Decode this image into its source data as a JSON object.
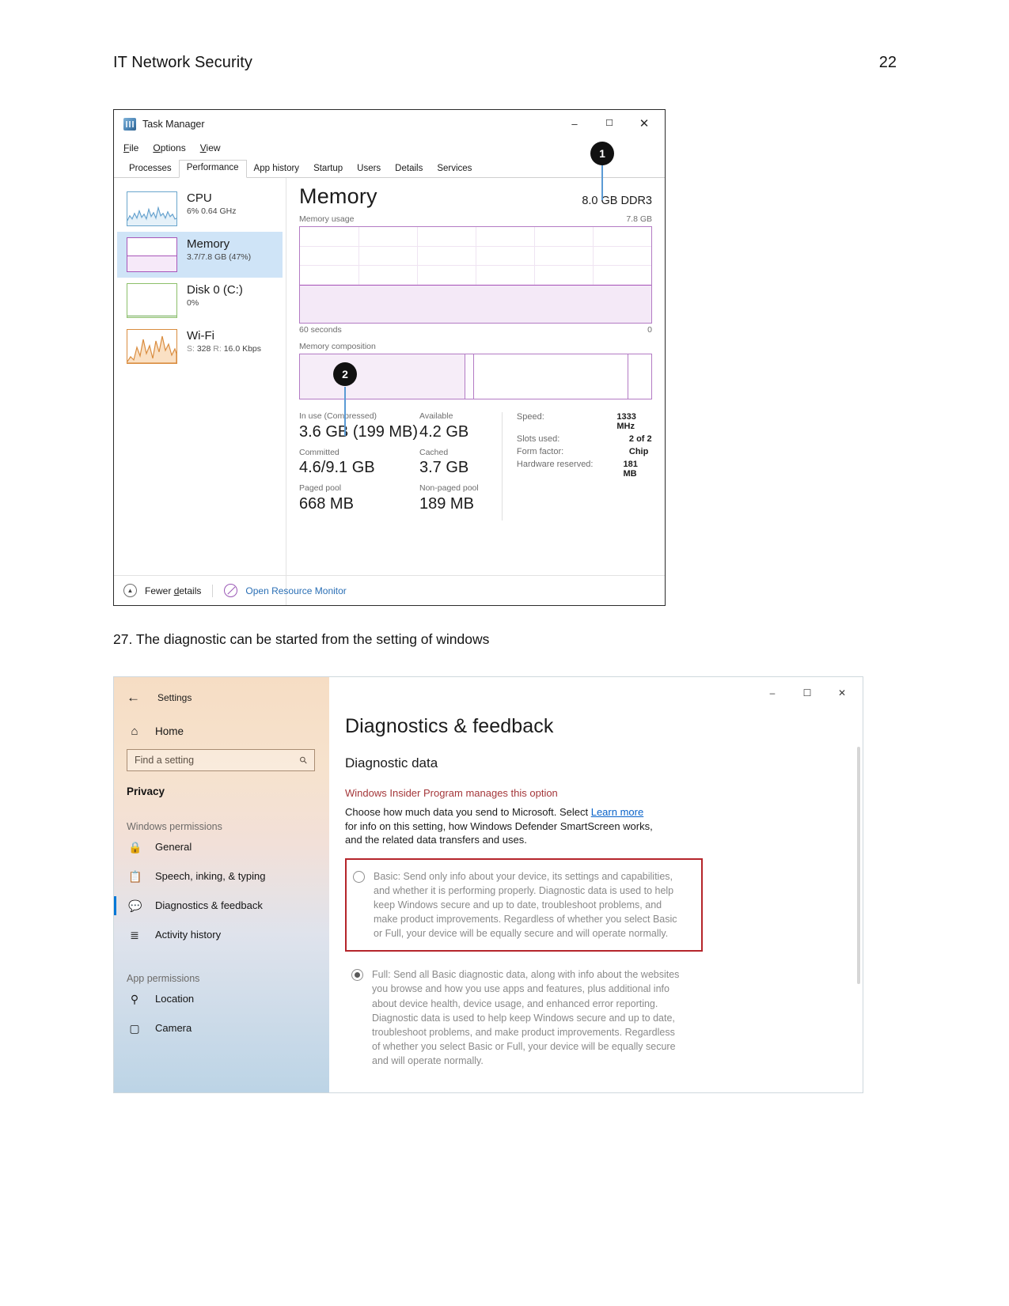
{
  "page": {
    "doc_title": "IT Network Security",
    "page_number": "22"
  },
  "task_manager": {
    "window_title": "Task Manager",
    "app_icon": "task-manager-icon",
    "window_controls": {
      "minimize": "–",
      "maximize": "☐",
      "close": "✕"
    },
    "menus": [
      "File",
      "Options",
      "View"
    ],
    "tabs": [
      "Processes",
      "Performance",
      "App history",
      "Startup",
      "Users",
      "Details",
      "Services"
    ],
    "active_tab": "Performance",
    "resources": [
      {
        "name": "CPU",
        "detail": "6%  0.64 GHz",
        "selected": false,
        "graph_color": "#4a90c4"
      },
      {
        "name": "Memory",
        "detail": "3.7/7.8 GB (47%)",
        "selected": true,
        "graph_color": "#a855b9"
      },
      {
        "name": "Disk 0 (C:)",
        "detail": "0%",
        "selected": false,
        "graph_color": "#6aa84f"
      },
      {
        "name": "Wi-Fi",
        "detail_prefix_s": "S:",
        "detail_s": "328",
        "detail_prefix_r": "R:",
        "detail_r": "16.0 Kbps",
        "selected": false,
        "graph_color": "#d98c3f"
      }
    ],
    "detail": {
      "title": "Memory",
      "capacity": "8.0 GB DDR3",
      "graph_label": "Memory usage",
      "graph_max": "7.8 GB",
      "axis_left": "60 seconds",
      "axis_right": "0",
      "composition_label": "Memory composition",
      "stats": [
        {
          "label": "In use (Compressed)",
          "value": "3.6 GB (199 MB)"
        },
        {
          "label": "Available",
          "value": "4.2 GB"
        },
        {
          "label": "Committed",
          "value": "4.6/9.1 GB"
        },
        {
          "label": "Cached",
          "value": "3.7 GB"
        },
        {
          "label": "Paged pool",
          "value": "668 MB"
        },
        {
          "label": "Non-paged pool",
          "value": "189 MB"
        }
      ],
      "hardware": [
        {
          "key": "Speed:",
          "value": "1333 MHz"
        },
        {
          "key": "Slots used:",
          "value": "2 of 2"
        },
        {
          "key": "Form factor:",
          "value": "Chip"
        },
        {
          "key": "Hardware reserved:",
          "value": "181 MB"
        }
      ]
    },
    "footer": {
      "fewer_details": "Fewer details",
      "open_resource_monitor": "Open Resource Monitor"
    },
    "callouts": [
      {
        "number": "1"
      },
      {
        "number": "2"
      }
    ]
  },
  "step": {
    "text": "27. The diagnostic can be started from the setting of windows"
  },
  "settings": {
    "back_label": "Settings",
    "back_icon": "back-arrow-icon",
    "home_label": "Home",
    "home_icon": "home-icon",
    "search_placeholder": "Find a setting",
    "search_icon": "search-icon",
    "category": "Privacy",
    "groups": [
      {
        "title": "Windows permissions"
      },
      {
        "title": "App permissions"
      }
    ],
    "nav_items": [
      {
        "label": "General",
        "icon": "lock-icon",
        "active": false
      },
      {
        "label": "Speech, inking, & typing",
        "icon": "clipboard-icon",
        "active": false
      },
      {
        "label": "Diagnostics & feedback",
        "icon": "feedback-icon",
        "active": true
      },
      {
        "label": "Activity history",
        "icon": "activity-icon",
        "active": false
      },
      {
        "label": "Location",
        "icon": "location-icon",
        "active": false
      },
      {
        "label": "Camera",
        "icon": "camera-icon",
        "active": false
      }
    ],
    "window_controls": {
      "minimize": "–",
      "maximize": "☐",
      "close": "✕"
    },
    "main": {
      "heading": "Diagnostics & feedback",
      "subheading": "Diagnostic data",
      "warning": "Windows Insider Program manages this option",
      "paragraph_before_link": "Choose how much data you send to Microsoft. Select ",
      "link_text": "Learn more",
      "paragraph_after_link": " for info on this setting, how Windows Defender SmartScreen works, and the related data transfers and uses.",
      "options": [
        {
          "id": "basic",
          "checked": false,
          "highlighted": true,
          "text": "Basic: Send only info about your device, its settings and capabilities, and whether it is performing properly. Diagnostic data is used to help keep Windows secure and up to date, troubleshoot problems, and make product improvements. Regardless of whether you select Basic or Full, your device will be equally secure and will operate normally."
        },
        {
          "id": "full",
          "checked": true,
          "highlighted": false,
          "text": "Full: Send all Basic diagnostic data, along with info about the websites you browse and how you use apps and features, plus additional info about device health, device usage, and enhanced error reporting. Diagnostic data is used to help keep Windows secure and up to date, troubleshoot problems, and make product improvements. Regardless of whether you select Basic or Full, your device will be equally secure and will operate normally."
        }
      ],
      "highlight_color": "#b5252b"
    }
  }
}
